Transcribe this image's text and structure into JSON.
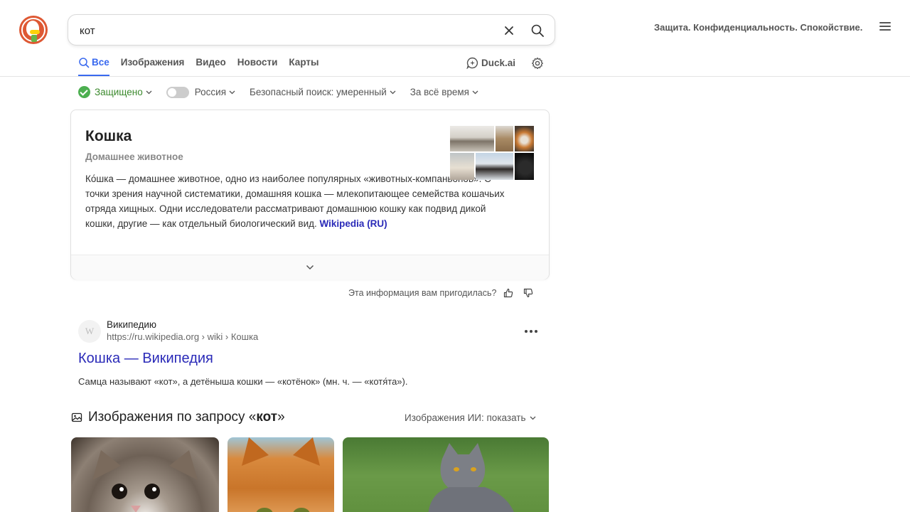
{
  "search": {
    "value": "кот"
  },
  "header": {
    "tagline": "Защита. Конфиденциальность. Спокойствие."
  },
  "tabs": [
    {
      "label": "Все",
      "active": true
    },
    {
      "label": "Изображения"
    },
    {
      "label": "Видео"
    },
    {
      "label": "Новости"
    },
    {
      "label": "Карты"
    }
  ],
  "duckai": {
    "label": "Duck.ai"
  },
  "filters": {
    "protected": "Защищено",
    "region": "Россия",
    "safe_search": "Безопасный поиск: умеренный",
    "time": "За всё время"
  },
  "knowledge": {
    "title": "Кошка",
    "subtitle": "Домашнее животное",
    "description": "Ко́шка — домашнее животное, одно из наиболее популярных «животных-компаньонов». С точки зрения научной систематики, домашняя кошка — млекопитающее семейства кошачьих отряда хищных. Одни исследователи рассматривают домашнюю кошку как подвид дикой кошки, другие — как отдельный биологический вид.",
    "source_link": "Wikipedia (RU)"
  },
  "feedback": {
    "question": "Эта информация вам пригодилась?"
  },
  "result": {
    "site_name": "Википедию",
    "favicon_letter": "W",
    "url": "https://ru.wikipedia.org › wiki › Кошка",
    "title": "Кошка — Википедия",
    "snippet": "Самца называют «кот», а детёныша кошки — «котёнок» (мн. ч. — «котя́та»)."
  },
  "images_section": {
    "heading_prefix": "Изображения по запросу «",
    "heading_query": "кот",
    "heading_suffix": "»",
    "ai_toggle": "Изображения ИИ: показать"
  },
  "colors": {
    "accent": "#3969ef",
    "link": "#2a2ab8",
    "protected_green": "#4caf50",
    "logo_orange": "#de5833"
  }
}
